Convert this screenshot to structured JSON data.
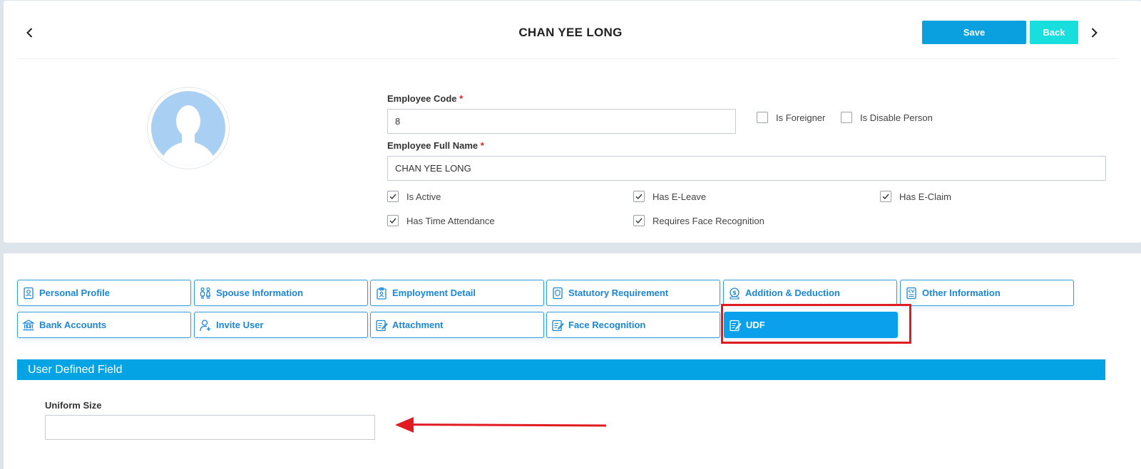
{
  "header": {
    "title": "CHAN YEE LONG",
    "save_label": "Save",
    "back_label": "Back"
  },
  "form": {
    "employee_code_label": "Employee Code",
    "employee_code_value": "8",
    "required_mark": "*",
    "employee_name_label": "Employee Full Name",
    "employee_name_value": "CHAN YEE LONG",
    "checkboxes": [
      {
        "label": "Is Foreigner",
        "checked": false
      },
      {
        "label": "Is Disable Person",
        "checked": false
      },
      {
        "label": "Is Active",
        "checked": true
      },
      {
        "label": "Has E-Leave",
        "checked": true
      },
      {
        "label": "Has E-Claim",
        "checked": true
      },
      {
        "label": "Has Time Attendance",
        "checked": true
      },
      {
        "label": "Requires Face Recognition",
        "checked": true
      }
    ]
  },
  "tabs": [
    {
      "label": "Personal Profile",
      "icon": "profile-icon"
    },
    {
      "label": "Spouse Information",
      "icon": "couple-icon"
    },
    {
      "label": "Employment Detail",
      "icon": "clipboard-icon"
    },
    {
      "label": "Statutory Requirement",
      "icon": "certificate-icon"
    },
    {
      "label": "Addition & Deduction",
      "icon": "money-icon"
    },
    {
      "label": "Other Information",
      "icon": "cv-icon"
    },
    {
      "label": "Bank Accounts",
      "icon": "bank-icon"
    },
    {
      "label": "Invite User",
      "icon": "add-user-icon"
    },
    {
      "label": "Attachment",
      "icon": "edit-document-icon"
    },
    {
      "label": "Face Recognition",
      "icon": "edit-document-icon"
    },
    {
      "label": "UDF",
      "icon": "edit-document-icon",
      "active": true
    }
  ],
  "udf": {
    "section_title": "User Defined Field",
    "uniform_size_label": "Uniform Size",
    "uniform_size_value": ""
  },
  "colors": {
    "primary": "#0aa0e0",
    "back_button": "#18dede",
    "annotation_red": "#e21b23"
  }
}
